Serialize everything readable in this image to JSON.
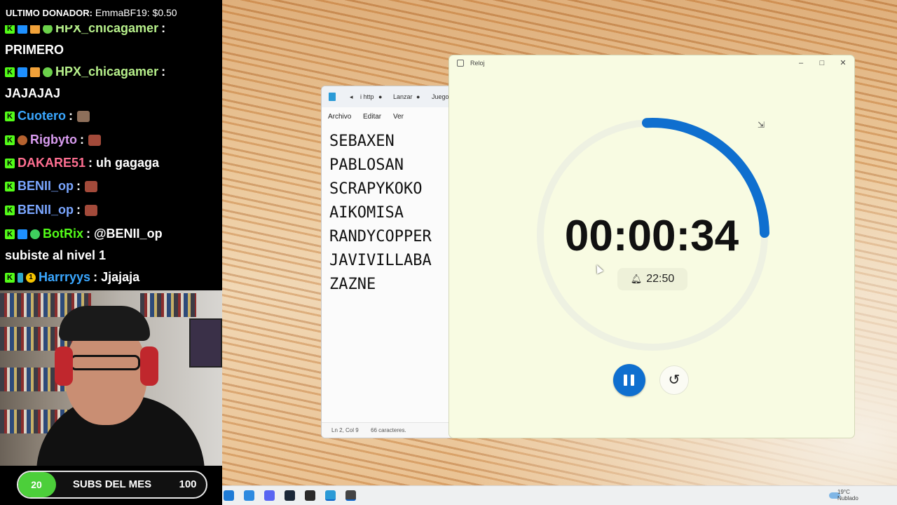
{
  "donor": {
    "label": "ULTIMO DONADOR:",
    "value": "EmmaBF19: $0.50"
  },
  "chat": {
    "messages": [
      {
        "badges": [
          "k",
          "mod",
          "box",
          "gem"
        ],
        "user": "HPX_chicagamer",
        "user_color": "#b7f08b",
        "sep": ":",
        "text": "",
        "cont": "PRIMERO"
      },
      {
        "badges": [
          "k",
          "mod",
          "box",
          "gem"
        ],
        "user": "HPX_chicagamer",
        "user_color": "#b7f08b",
        "sep": ":",
        "text": "",
        "cont": "JAJAJAJ"
      },
      {
        "badges": [
          "k"
        ],
        "user": "Cuotero",
        "user_color": "#3aa7ff",
        "sep": ":",
        "text": "",
        "emote": "#8e6f5a"
      },
      {
        "badges": [
          "k",
          "apple"
        ],
        "user": "Rigbyto",
        "user_color": "#d99cf0",
        "sep": ":",
        "text": "",
        "emote": "#a34a3a"
      },
      {
        "badges": [
          "k"
        ],
        "user": "DAKARE51",
        "user_color": "#ff6f91",
        "sep": ":",
        "text": "uh gagaga"
      },
      {
        "badges": [
          "k"
        ],
        "user": "BENII_op",
        "user_color": "#7aa6ff",
        "sep": ":",
        "text": "",
        "emote": "#a34a3a"
      },
      {
        "badges": [
          "k"
        ],
        "user": "BENII_op",
        "user_color": "#7aa6ff",
        "sep": ":",
        "text": "",
        "emote": "#a34a3a"
      },
      {
        "badges": [
          "k",
          "mod",
          "check"
        ],
        "user": "BotRix",
        "user_color": "#53fc18",
        "sep": ":",
        "text": "@BENII_op",
        "cont": "subiste al nivel 1"
      },
      {
        "badges": [
          "k",
          "bottle",
          "one"
        ],
        "user": "Harrryys",
        "user_color": "#3aa7ff",
        "sep": ":",
        "text": "Jjajaja"
      }
    ]
  },
  "subs": {
    "current": "20",
    "title": "SUBS DEL MES",
    "goal": "100",
    "progress": 0.2,
    "fill_color": "#4ccf3a"
  },
  "notepad": {
    "tabs": [
      "i http",
      "Lanzar",
      "Juego"
    ],
    "menu": [
      "Archivo",
      "Editar",
      "Ver"
    ],
    "lines": [
      "SEBAXEN",
      "PABLOSAN",
      "SCRAPYKOKO",
      "AIKOMISA",
      "RANDYCOPPER",
      "JAVIVILLABA",
      "ZAZNE"
    ],
    "status_pos": "Ln 2, Col 9",
    "status_chars": "66 caracteres."
  },
  "clock": {
    "title": "Reloj",
    "timer": "00:00:34",
    "alarm": "22:50",
    "progress": 0.255,
    "accent": "#0f6fcf",
    "controls": {
      "minimize": "–",
      "maximize": "□",
      "close": "✕"
    }
  },
  "taskbar": {
    "icons": [
      {
        "name": "start-icon",
        "color": "#1e7bd6"
      },
      {
        "name": "mail-icon",
        "color": "#2d8ae0"
      },
      {
        "name": "discord-icon",
        "color": "#5865f2"
      },
      {
        "name": "steam-icon",
        "color": "#1b2838"
      },
      {
        "name": "obs-icon",
        "color": "#2a2a2a"
      },
      {
        "name": "notepad-icon",
        "color": "#2a9ad6"
      },
      {
        "name": "clock-icon",
        "color": "#444444"
      }
    ],
    "weather_temp": "19°C",
    "weather_desc": "Nublado"
  }
}
